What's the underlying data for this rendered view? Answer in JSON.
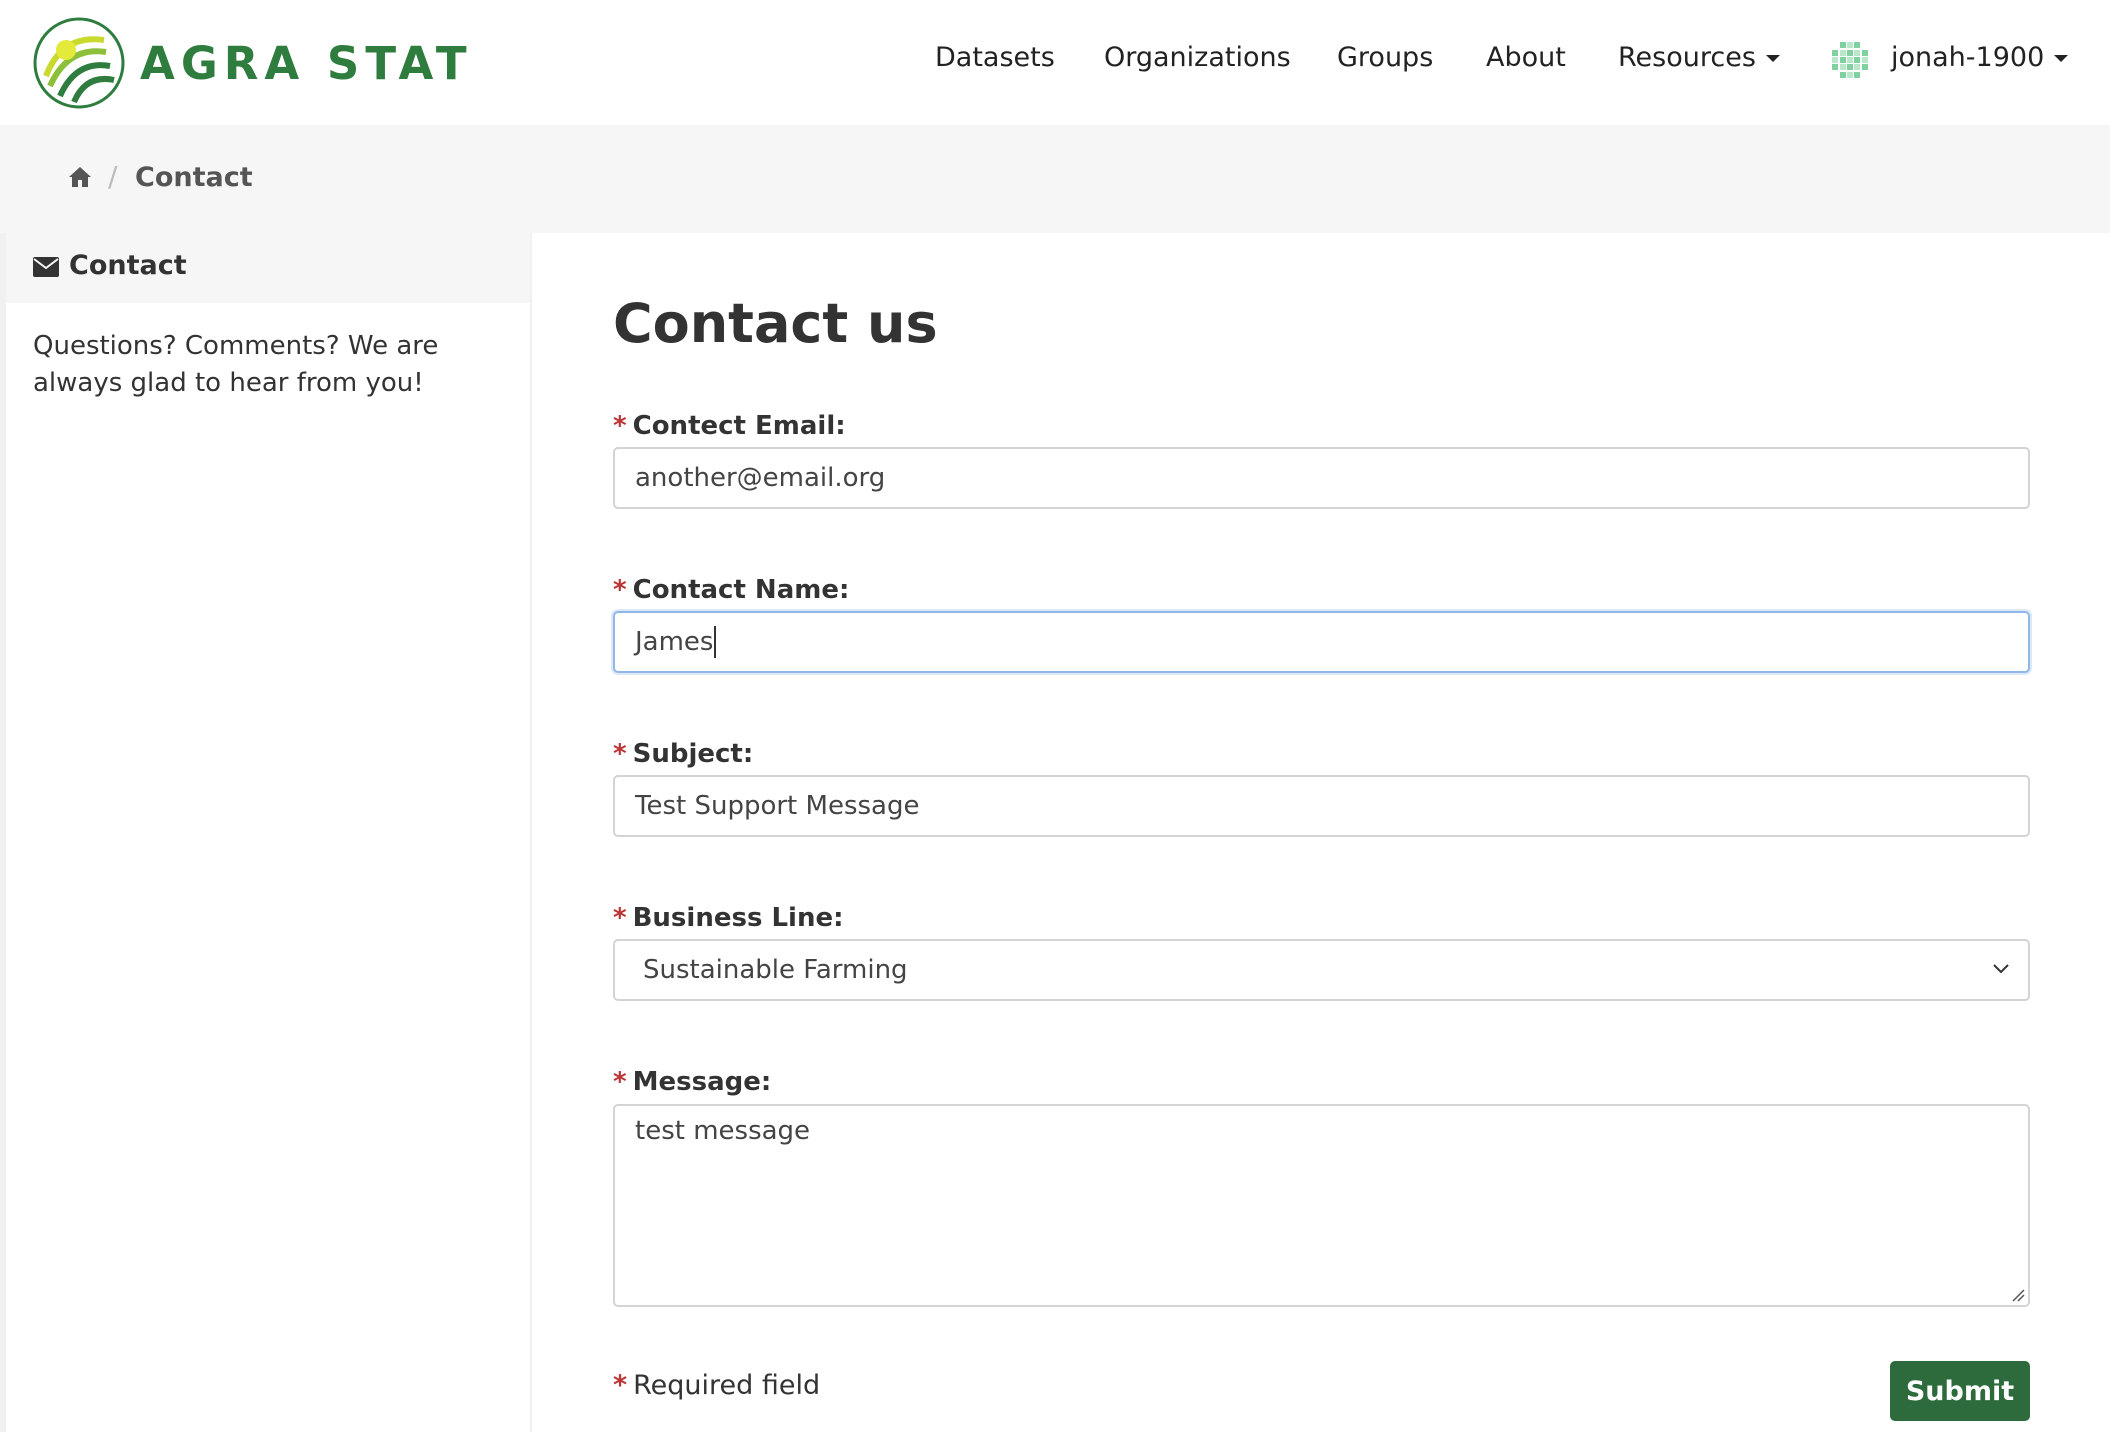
{
  "brand": {
    "name": "AGRA STAT",
    "color": "#2e7d3f"
  },
  "nav": {
    "items": [
      {
        "label": "Datasets"
      },
      {
        "label": "Organizations"
      },
      {
        "label": "Groups"
      },
      {
        "label": "About"
      },
      {
        "label": "Resources"
      }
    ],
    "user": "jonah-1900"
  },
  "breadcrumb": {
    "current": "Contact"
  },
  "sidebar": {
    "heading": "Contact",
    "text": "Questions? Comments? We are always glad to hear from you!"
  },
  "form": {
    "title": "Contact us",
    "required_marker": "*",
    "email": {
      "label": "Contect Email:",
      "value": "another@email.org"
    },
    "name": {
      "label": "Contact Name:",
      "value": "James"
    },
    "subject": {
      "label": "Subject:",
      "value": "Test Support Message"
    },
    "business_line": {
      "label": "Business Line:",
      "value": "Sustainable Farming"
    },
    "message": {
      "label": "Message:",
      "value": "test message"
    },
    "required_note": "Required field",
    "submit_label": "Submit"
  },
  "colors": {
    "accent": "#2d6b3c",
    "required": "#b33333"
  }
}
